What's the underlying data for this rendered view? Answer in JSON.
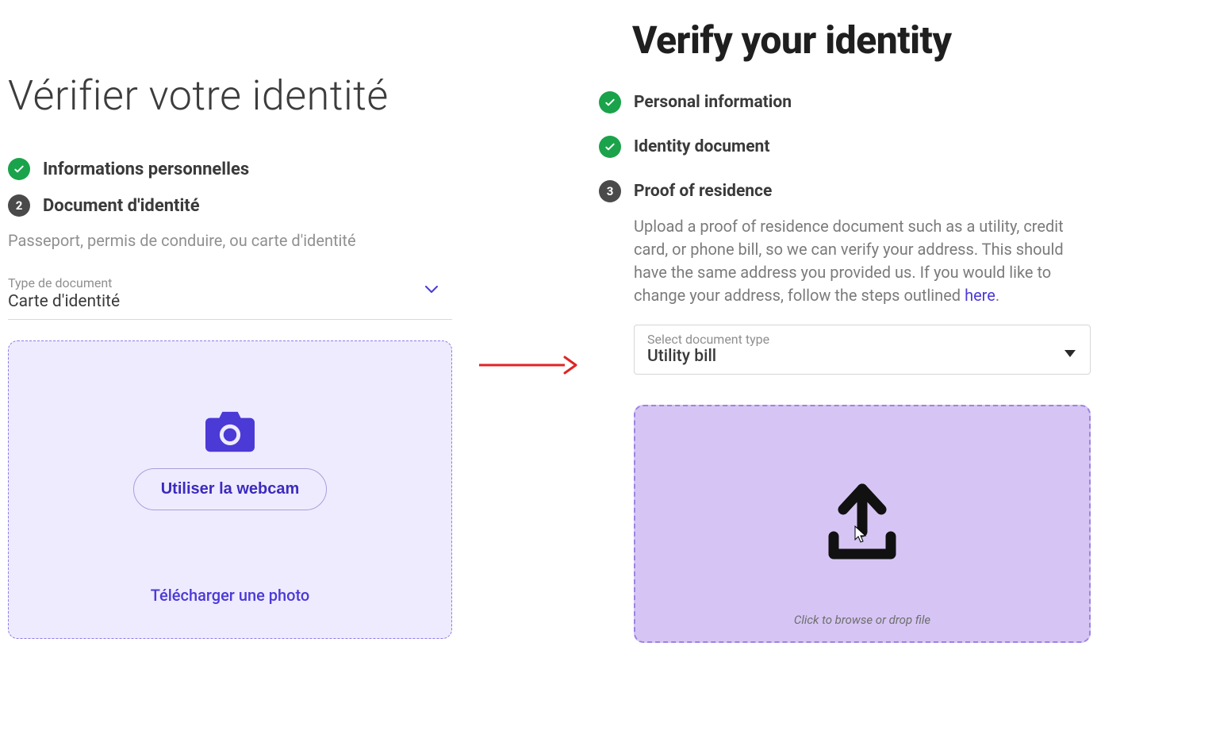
{
  "left": {
    "title": "Vérifier votre identité",
    "steps": [
      {
        "label": "Informations personnelles"
      },
      {
        "num": "2",
        "label": "Document d'identité"
      }
    ],
    "subtitle": "Passeport, permis de conduire, ou carte d'identité",
    "select": {
      "label": "Type de document",
      "value": "Carte d'identité"
    },
    "webcam_button": "Utiliser la webcam",
    "download_link": "Télécharger une photo"
  },
  "right": {
    "title": "Verify your identity",
    "steps": [
      {
        "label": "Personal information"
      },
      {
        "label": "Identity document"
      },
      {
        "num": "3",
        "label": "Proof of residence"
      }
    ],
    "description_pre": "Upload a proof of residence document such as a utility, credit card, or phone bill, so we can verify your address. This should have the same address you provided us. If you would like to change your address, follow the steps outlined ",
    "description_link": "here",
    "description_post": ".",
    "select": {
      "label": "Select document type",
      "value": "Utility bill"
    },
    "drop_text": "Click to browse or drop file"
  }
}
